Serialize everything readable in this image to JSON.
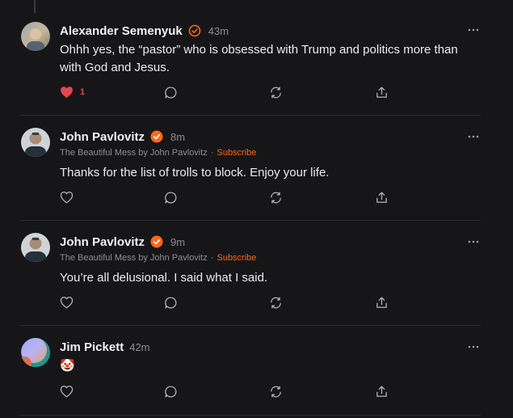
{
  "colors": {
    "background": "#161618",
    "accent": "#ff6719",
    "like_active": "#e8454f",
    "muted": "#8e8e93"
  },
  "comments": [
    {
      "author": "Alexander Semenyuk",
      "verified_style": "outline",
      "time": "43m",
      "byline": null,
      "body": "Ohhh yes, the “pastor” who is obsessed with Trump and politics more than with God and Jesus.",
      "liked": true,
      "like_count": "1",
      "avatar": "photo-avatar"
    },
    {
      "author": "John Pavlovitz",
      "verified_style": "filled",
      "time": "8m",
      "byline": {
        "publication": "The Beautiful Mess by John Pavlovitz",
        "separator": "·",
        "subscribe": "Subscribe"
      },
      "body": "Thanks for the list of trolls to block. Enjoy your life.",
      "liked": false,
      "like_count": "",
      "avatar": "photo-avatar"
    },
    {
      "author": "John Pavlovitz",
      "verified_style": "filled",
      "time": "9m",
      "byline": {
        "publication": "The Beautiful Mess by John Pavlovitz",
        "separator": "·",
        "subscribe": "Subscribe"
      },
      "body": "You’re all delusional. I said what I said.",
      "liked": false,
      "like_count": "",
      "avatar": "photo-avatar"
    },
    {
      "author": "Jim Pickett",
      "verified_style": "none",
      "time": "42m",
      "byline": null,
      "body": "🤡",
      "liked": false,
      "like_count": "",
      "avatar": "gradient-avatar"
    }
  ],
  "icons": {
    "like": "heart-icon",
    "reply": "comment-bubble-icon",
    "restack": "restack-icon",
    "share": "share-icon",
    "more": "more-options-icon",
    "verified": "verified-check-icon"
  }
}
